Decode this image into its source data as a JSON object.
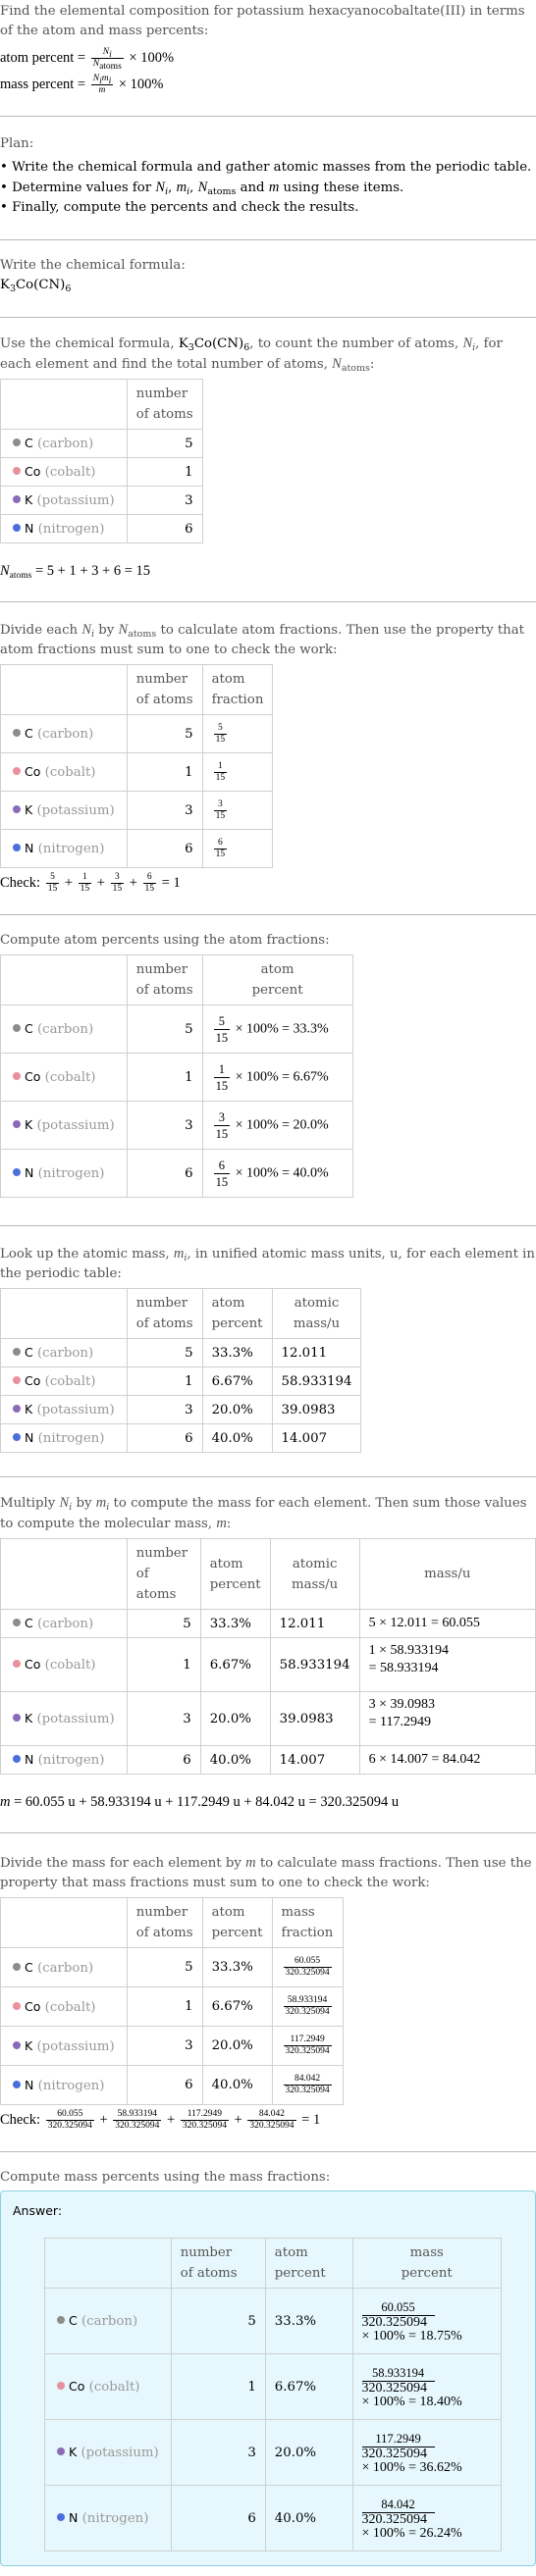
{
  "question": {
    "text": "Find the elemental composition for potassium hexacyanocobaltate(III) in terms of the atom and mass percents:",
    "atom_percent_label": "atom percent",
    "mass_percent_label": "mass percent",
    "atom_formula": {
      "num": "N",
      "num_sub": "i",
      "den": "N",
      "den_sub": "atoms",
      "times": "× 100%"
    },
    "mass_formula": {
      "num": "N",
      "num_sub": "i",
      "num2": "m",
      "num2_sub": "i",
      "den": "m",
      "times": "× 100%"
    }
  },
  "plan": {
    "title": "Plan:",
    "items": [
      "Write the chemical formula and gather atomic masses from the periodic table.",
      "Determine values for N_i, m_i, N_atoms and m using these items.",
      "Finally, compute the percents and check the results."
    ],
    "item2_parts": {
      "prefix": "Determine values for ",
      "suffix": " and ",
      "end": " using these items."
    }
  },
  "formula_step": {
    "intro": "Write the chemical formula:",
    "formula": {
      "k": "K",
      "k_sub": "3",
      "rest": "Co(CN)",
      "rest_sub": "6"
    }
  },
  "count_step": {
    "intro_a": "Use the chemical formula, ",
    "intro_b": ", to count the number of atoms, ",
    "intro_c": ", for each element and find the total number of atoms, ",
    "intro_d": ":",
    "total_line": "= 5 + 1 + 3 + 6 = 15"
  },
  "headers": {
    "number_of_atoms": [
      "number",
      "of atoms"
    ],
    "atom_fraction": [
      "atom",
      "fraction"
    ],
    "atom_percent": [
      "atom",
      "percent"
    ],
    "atomic_mass": [
      "atomic",
      "mass/u"
    ],
    "mass": "mass/u",
    "mass_fraction": [
      "mass",
      "fraction"
    ],
    "mass_percent": [
      "mass",
      "percent"
    ]
  },
  "elements": [
    {
      "symbol": "C",
      "name": "(carbon)",
      "color": "#8c8c8c",
      "count": "5",
      "fraction_num": "5",
      "fraction_den": "15",
      "atom_percent_calc": "× 100% = 33.3%",
      "atom_percent": "33.3%",
      "atomic_mass": "12.011",
      "mass_calc_1": "5 × 12.011 = 60.055",
      "mass_calc_2": "",
      "mass": "60.055",
      "mass_percent_calc": "× 100% = 18.75%",
      "mass_percent": 18.75
    },
    {
      "symbol": "Co",
      "name": "(cobalt)",
      "color": "#e8909c",
      "count": "1",
      "fraction_num": "1",
      "fraction_den": "15",
      "atom_percent_calc": "× 100% = 6.67%",
      "atom_percent": "6.67%",
      "atomic_mass": "58.933194",
      "mass_calc_1": "1 × 58.933194",
      "mass_calc_2": "= 58.933194",
      "mass": "58.933194",
      "mass_percent_calc": "× 100% = 18.40%",
      "mass_percent": 18.4
    },
    {
      "symbol": "K",
      "name": "(potassium)",
      "color": "#8a6bb8",
      "count": "3",
      "fraction_num": "3",
      "fraction_den": "15",
      "atom_percent_calc": "× 100% = 20.0%",
      "atom_percent": "20.0%",
      "atomic_mass": "39.0983",
      "mass_calc_1": "3 × 39.0983",
      "mass_calc_2": "= 117.2949",
      "mass": "117.2949",
      "mass_percent_calc": "× 100% = 36.62%",
      "mass_percent": 36.62
    },
    {
      "symbol": "N",
      "name": "(nitrogen)",
      "color": "#4a6fdc",
      "count": "6",
      "fraction_num": "6",
      "fraction_den": "15",
      "atom_percent_calc": "× 100% = 40.0%",
      "atom_percent": "40.0%",
      "atomic_mass": "14.007",
      "mass_calc_1": "6 × 14.007 = 84.042",
      "mass_calc_2": "",
      "mass": "84.042",
      "mass_percent_calc": "× 100% = 26.24%",
      "mass_percent": 26.24
    }
  ],
  "fraction_step": {
    "intro_a": "Divide each ",
    "intro_b": " by ",
    "intro_c": " to calculate atom fractions. Then use the property that atom fractions must sum to one to check the work:",
    "check_label": "Check:",
    "check_result": "= 1"
  },
  "atom_percent_step": {
    "intro": "Compute atom percents using the atom fractions:"
  },
  "mass_lookup_step": {
    "intro_a": "Look up the atomic mass, ",
    "intro_b": ", in unified atomic mass units, u, for each element in the periodic table:"
  },
  "mass_step": {
    "intro_a": "Multiply ",
    "intro_b": " by ",
    "intro_c": " to compute the mass for each element. Then sum those values to compute the molecular mass, ",
    "intro_d": ":",
    "sum_line": "= 60.055 u + 58.933194 u + 117.2949 u + 84.042 u = 320.325094 u",
    "molecular_mass": "320.325094"
  },
  "mass_fraction_step": {
    "intro_a": "Divide the mass for each element by ",
    "intro_b": " to calculate mass fractions. Then use the property that mass fractions must sum to one to check the work:",
    "check_label": "Check:",
    "check_result": "= 1"
  },
  "mass_percent_step": {
    "intro": "Compute mass percents using the mass fractions:",
    "answer_label": "Answer:"
  },
  "colors": {
    "answer_bg": "#e6f8fd",
    "answer_border": "#8ccfde",
    "divider": "#b8b8b8"
  }
}
